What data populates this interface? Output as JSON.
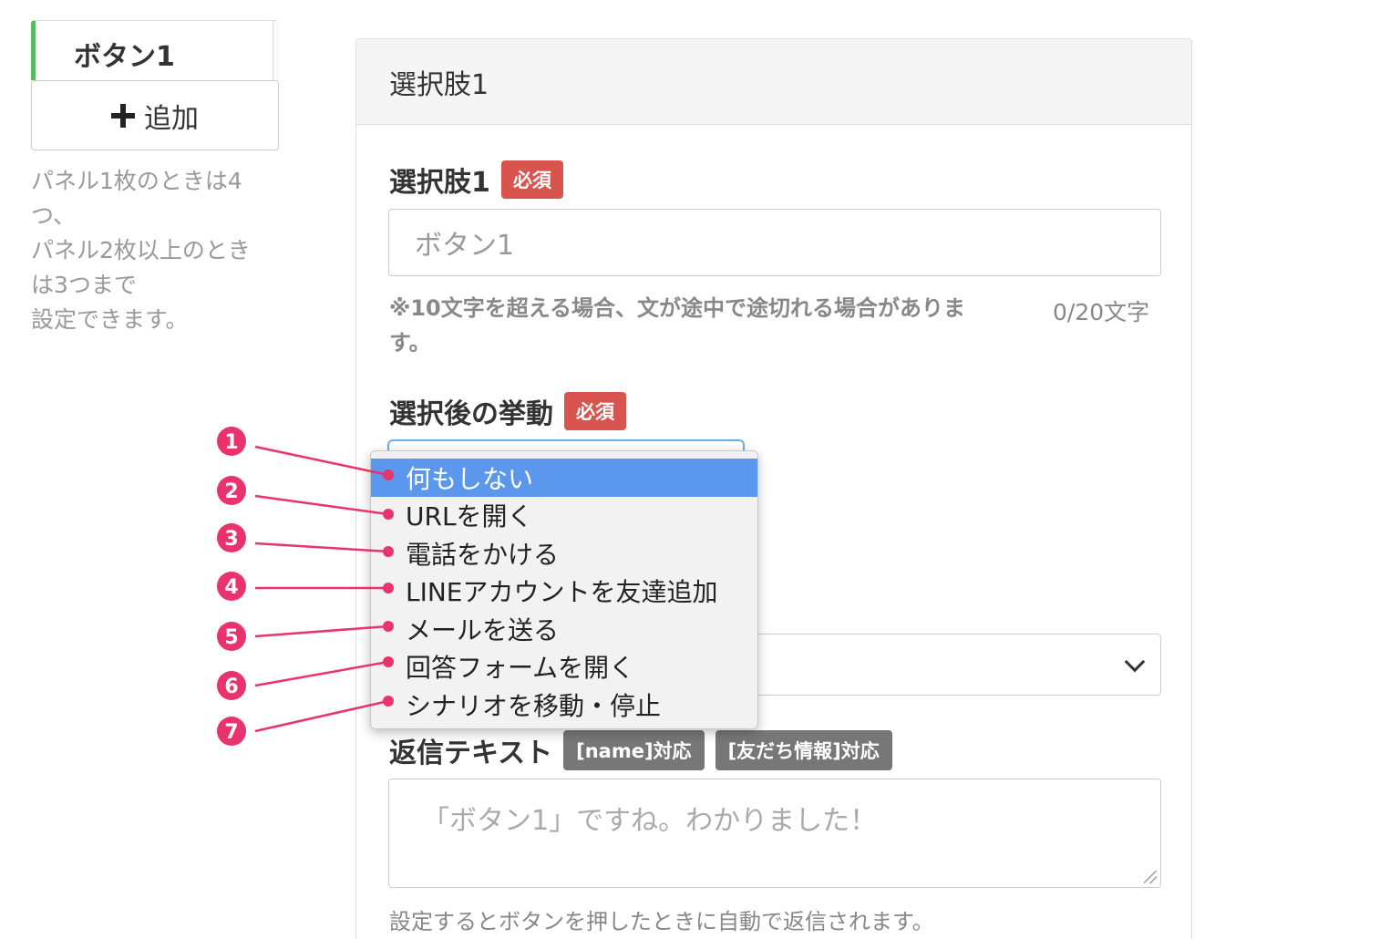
{
  "tabs": {
    "active_label": "ボタン1",
    "add_label": "追加",
    "note_lines": [
      "パネル1枚のときは4",
      "つ、",
      "パネル2枚以上のとき",
      "は3つまで",
      "設定できます。"
    ]
  },
  "panel": {
    "heading": "選択肢1",
    "choice_field": {
      "label": "選択肢1",
      "required_badge": "必須",
      "placeholder": "ボタン1",
      "help_line1": "※10文字を超える場合、文が途中で途切れる場合がありま",
      "help_line2": "す。",
      "counter": "0/20文字"
    },
    "action_field": {
      "label": "選択後の挙動",
      "required_badge": "必須"
    },
    "reply_field": {
      "label": "返信テキスト",
      "badge_name": "[name]対応",
      "badge_friend": "[友だち情報]対応",
      "placeholder": "「ボタン1」ですね。わかりました！",
      "help": "設定するとボタンを押したときに自動で返信されます。"
    }
  },
  "dropdown": {
    "options": [
      {
        "label": "何もしない",
        "selected": true
      },
      {
        "label": "URLを開く"
      },
      {
        "label": "電話をかける"
      },
      {
        "label": "LINEアカウントを友達追加"
      },
      {
        "label": "メールを送る"
      },
      {
        "label": "回答フォームを開く"
      },
      {
        "label": "シナリオを移動・停止"
      }
    ]
  },
  "annotations": {
    "markers": [
      "1",
      "2",
      "3",
      "4",
      "5",
      "6",
      "7"
    ],
    "color": "#e8336d"
  },
  "colors": {
    "required_badge": "#d9534f",
    "tab_accent": "#5cb85c",
    "dropdown_selected": "#5b97ec",
    "info_badge": "#777777"
  }
}
